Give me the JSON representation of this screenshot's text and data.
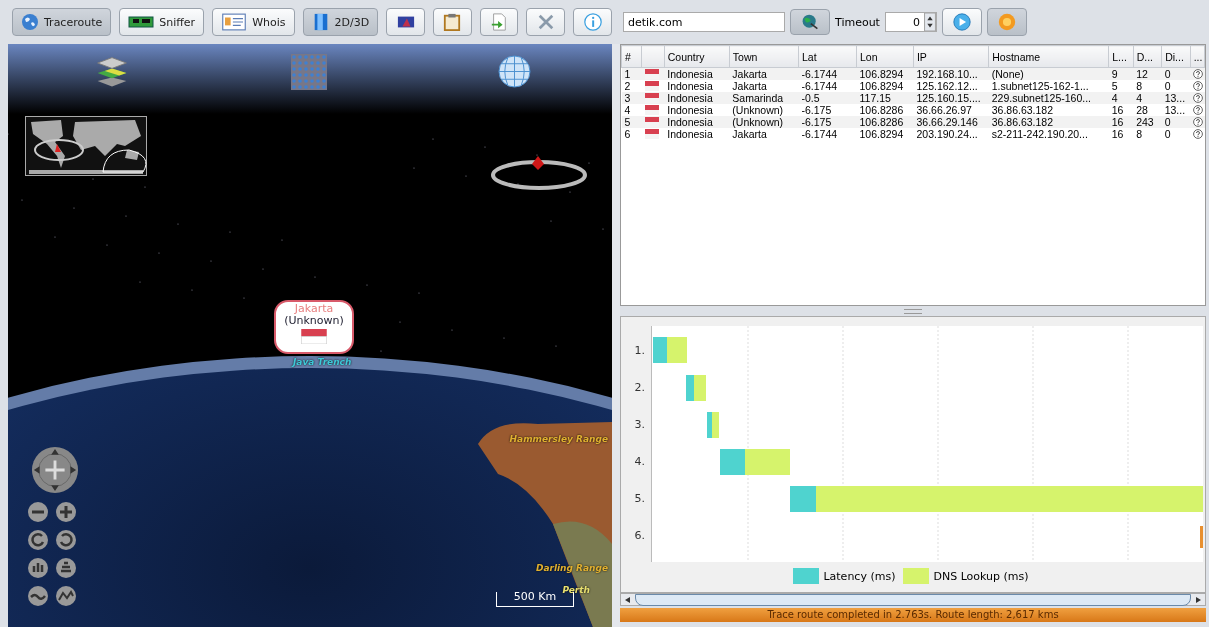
{
  "toolbar": {
    "modes": [
      {
        "label": "Traceroute",
        "selected": true
      },
      {
        "label": "Sniffer",
        "selected": false
      },
      {
        "label": "Whois",
        "selected": false
      },
      {
        "label": "2D/3D",
        "selected": true
      }
    ]
  },
  "map": {
    "marker": {
      "title": "Jakarta",
      "subtitle": "(Unknown)"
    },
    "place_labels": [
      {
        "text": "Java Trench",
        "kind": "sea"
      },
      {
        "text": "Hammersley Range",
        "kind": "land"
      },
      {
        "text": "Darling Range",
        "kind": "land"
      },
      {
        "text": "Perth",
        "kind": "city"
      }
    ],
    "scale": "500 Km"
  },
  "trace": {
    "host": "detik.com",
    "timeout_label": "Timeout",
    "timeout": "0"
  },
  "table": {
    "columns": [
      "#",
      "Country",
      "Town",
      "Lat",
      "Lon",
      "IP",
      "Hostname",
      "L...",
      "D...",
      "Di...",
      "..."
    ],
    "rows": [
      {
        "cells": [
          "1",
          "Indonesia",
          "Jakarta",
          "-6.1744",
          "106.8294",
          "192.168.10...",
          "(None)",
          "9",
          "12",
          "0"
        ]
      },
      {
        "cells": [
          "2",
          "Indonesia",
          "Jakarta",
          "-6.1744",
          "106.8294",
          "125.162.12...",
          "1.subnet125-162-1...",
          "5",
          "8",
          "0"
        ]
      },
      {
        "cells": [
          "3",
          "Indonesia",
          "Samarinda",
          "-0.5",
          "117.15",
          "125.160.15....",
          "229.subnet125-160...",
          "4",
          "4",
          "13..."
        ]
      },
      {
        "cells": [
          "4",
          "Indonesia",
          "(Unknown)",
          "-6.175",
          "106.8286",
          "36.66.26.97",
          "36.86.63.182",
          "16",
          "28",
          "13..."
        ]
      },
      {
        "cells": [
          "5",
          "Indonesia",
          "(Unknown)",
          "-6.175",
          "106.8286",
          "36.66.29.146",
          "36.86.63.182",
          "16",
          "243",
          "0"
        ]
      },
      {
        "cells": [
          "6",
          "Indonesia",
          "Jakarta",
          "-6.1744",
          "106.8294",
          "203.190.24...",
          "s2-211-242.190.20...",
          "16",
          "8",
          "0"
        ]
      }
    ]
  },
  "timeline": {
    "hops": [
      "1.",
      "2.",
      "3.",
      "4.",
      "5.",
      "6."
    ],
    "legend": [
      {
        "label": "Latency (ms)",
        "color": "#4fd3cf"
      },
      {
        "label": "DNS Lookup (ms)",
        "color": "#d6f36c"
      }
    ]
  },
  "status_bar": "Trace route completed in 2.763s. Route length: 2,617 kms"
}
